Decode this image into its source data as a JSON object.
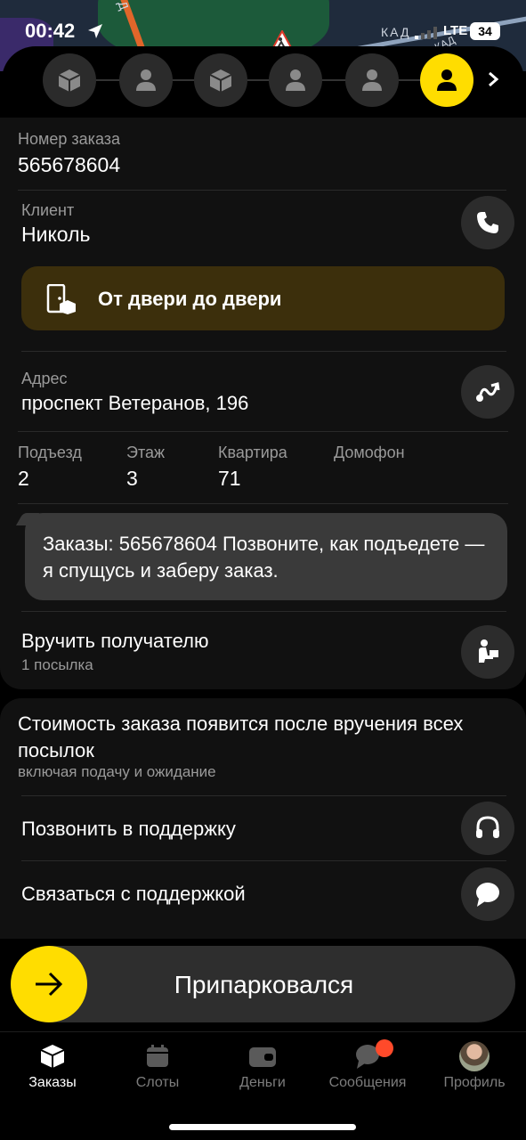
{
  "status_bar": {
    "time": "00:42",
    "network": "LTE",
    "battery": "34"
  },
  "map": {
    "road_label_1": "КАД",
    "road_label_2": "КАД",
    "road_label_3": "Д"
  },
  "stepper": {
    "steps": [
      "box-icon",
      "person-icon",
      "box-icon",
      "person-icon",
      "person-icon",
      "person-icon"
    ],
    "active_index": 5
  },
  "order": {
    "number_label": "Номер заказа",
    "number_value": "565678604"
  },
  "client": {
    "label": "Клиент",
    "name": "Николь"
  },
  "delivery_type": {
    "label": "От двери до двери"
  },
  "address": {
    "label": "Адрес",
    "value": "проспект Ветеранов, 196"
  },
  "address_details": {
    "entrance_label": "Подъезд",
    "entrance_value": "2",
    "floor_label": "Этаж",
    "floor_value": "3",
    "apartment_label": "Квартира",
    "apartment_value": "71",
    "intercom_label": "Домофон",
    "intercom_value": ""
  },
  "comment": {
    "text": "Заказы: 565678604  Позвоните, как подъедете — я спущусь и заберу заказ."
  },
  "handover": {
    "title": "Вручить получателю",
    "subtitle": "1 посылка"
  },
  "cost": {
    "title": "Стоимость заказа появится после вручения всех посылок",
    "subtitle": "включая подачу и ожидание"
  },
  "support": {
    "call_label": "Позвонить в поддержку",
    "chat_label": "Связаться с поддержкой"
  },
  "action": {
    "parked_label": "Припарковался"
  },
  "tabs": [
    {
      "label": "Заказы",
      "icon": "orders-icon",
      "active": true
    },
    {
      "label": "Слоты",
      "icon": "calendar-icon",
      "active": false
    },
    {
      "label": "Деньги",
      "icon": "wallet-icon",
      "active": false
    },
    {
      "label": "Сообщения",
      "icon": "chat-icon",
      "active": false
    },
    {
      "label": "Профиль",
      "icon": "avatar",
      "active": false
    }
  ],
  "colors": {
    "accent": "#ffdd00",
    "door_bg": "#3c2f0c",
    "badge": "#ff4a2a",
    "panel": "#111111"
  }
}
